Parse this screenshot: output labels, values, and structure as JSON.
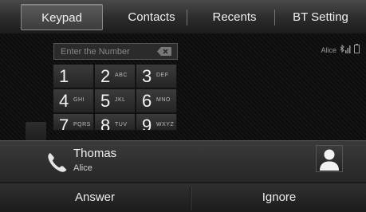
{
  "tabs": [
    {
      "label": "Keypad",
      "active": true
    },
    {
      "label": "Contacts",
      "active": false
    },
    {
      "label": "Recents",
      "active": false
    },
    {
      "label": "BT Setting",
      "active": false
    }
  ],
  "dial": {
    "placeholder": "Enter the Number",
    "value": ""
  },
  "status": {
    "device_name": "Alice",
    "icons": [
      "bluetooth-signal-icon",
      "battery-icon"
    ]
  },
  "keypad": {
    "keys": [
      {
        "digit": "1",
        "letters": ""
      },
      {
        "digit": "2",
        "letters": "ABC"
      },
      {
        "digit": "3",
        "letters": "DEF"
      },
      {
        "digit": "4",
        "letters": "GHI"
      },
      {
        "digit": "5",
        "letters": "JKL"
      },
      {
        "digit": "6",
        "letters": "MNO"
      },
      {
        "digit": "7",
        "letters": "PQRS"
      },
      {
        "digit": "8",
        "letters": "TUV"
      },
      {
        "digit": "9",
        "letters": "WXYZ"
      }
    ]
  },
  "incoming_call": {
    "caller_name": "Thomas",
    "caller_subtext": "Alice"
  },
  "actions": {
    "answer_label": "Answer",
    "ignore_label": "Ignore"
  },
  "colors": {
    "background": "#000000",
    "accent_text": "#f0f0f0",
    "panel": "#303030"
  }
}
